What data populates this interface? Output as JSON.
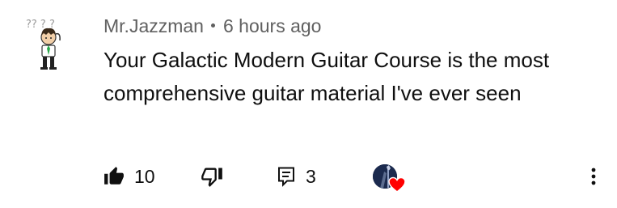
{
  "comment": {
    "author": "Mr.Jazzman",
    "time": "6 hours ago",
    "text": "Your Galactic Modern Guitar Course is the most comprehensive guitar material I've ever seen",
    "avatar_text": "?? ? ?"
  },
  "actions": {
    "like_count": "10",
    "reply_count": "3",
    "icons": {
      "like": "thumb-up-filled-icon",
      "dislike": "thumb-down-outline-icon",
      "reply": "comment-reply-icon",
      "heart": "creator-heart-icon",
      "more": "more-vert-icon"
    }
  },
  "colors": {
    "text": "#0f0f0f",
    "secondary": "#606060",
    "heart": "#ff0000"
  }
}
